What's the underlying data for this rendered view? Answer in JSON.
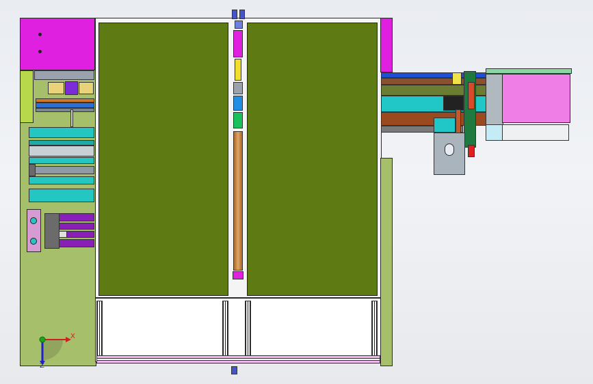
{
  "viewport": {
    "background": "#eceff3",
    "triad": {
      "x_label": "X",
      "y_label": "Y",
      "z_label": "Z",
      "x_color": "#d11f1f",
      "y_color": "#1aa81a",
      "z_color": "#1f1fd1"
    }
  },
  "colors": {
    "frame_base": "#a6bf6b",
    "panel_fill": "#5e7a12",
    "panel_border": "#ffffff",
    "magenta": "#e020e0",
    "purple": "#8a1fb8",
    "cyan": "#21c7c7",
    "brown": "#9b4a1f",
    "pink": "#ef7fe6",
    "blue": "#1f4fd6",
    "green": "#18b05a",
    "light_blue": "#c4ecf7"
  }
}
